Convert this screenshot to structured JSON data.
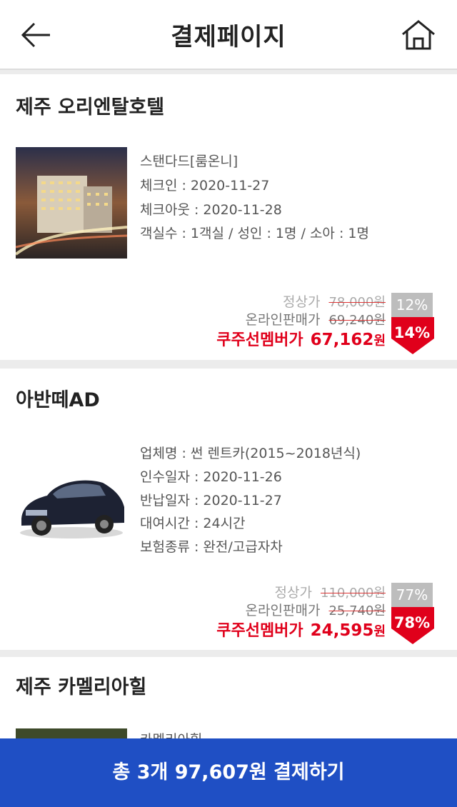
{
  "header": {
    "title": "결제페이지"
  },
  "items": [
    {
      "title": "제주 오리엔탈호텔",
      "lines": [
        "스탠다드[룸온니]",
        "체크인 : 2020-11-27",
        "체크아웃 : 2020-11-28",
        "객실수 : 1객실 / 성인 : 1명 / 소아 : 1명"
      ],
      "regular_label": "정상가",
      "regular_price": "78,000원",
      "online_label": "온라인판매가",
      "online_price": "69,240원",
      "member_label": "쿠주선멤버가",
      "member_price": "67,162",
      "won": "원",
      "online_discount": "12%",
      "member_discount": "14%",
      "thumb_icon": "hotel-photo"
    },
    {
      "title": "아반떼AD",
      "lines": [
        "업체명 : 썬 렌트카(2015~2018년식)",
        "인수일자 : 2020-11-26",
        "반납일자 : 2020-11-27",
        "대여시간 : 24시간",
        "보험종류 : 완전/고급자차"
      ],
      "regular_label": "정상가",
      "regular_price": "110,000원",
      "online_label": "온라인판매가",
      "online_price": "25,740원",
      "member_label": "쿠주선멤버가",
      "member_price": "24,595",
      "won": "원",
      "online_discount": "77%",
      "member_discount": "78%",
      "thumb_icon": "car-photo"
    },
    {
      "title": "제주 카멜리아힐",
      "lines": [
        "카멜리아힐"
      ],
      "thumb_icon": "garden-photo"
    }
  ],
  "pay_button": {
    "label": "총 3개 97,607원 결제하기"
  },
  "colors": {
    "accent_blue": "#1f4fc4",
    "member_red": "#e0001b",
    "badge_gray": "#bdbdbd"
  }
}
